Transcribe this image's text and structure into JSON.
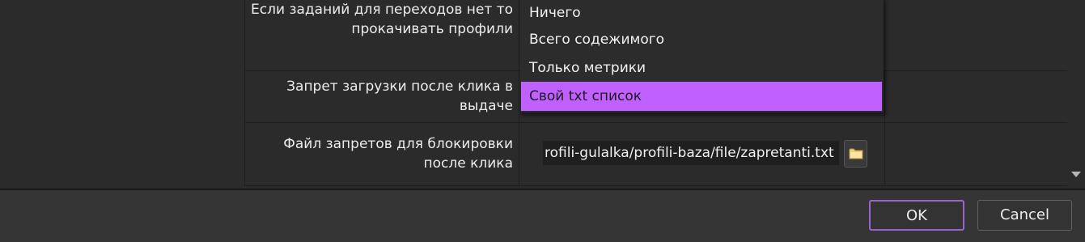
{
  "settings": {
    "rows": [
      {
        "label_line1": "Если заданий для переходов нет то",
        "label_line2": "прокачивать профили"
      },
      {
        "label_line1": "Запрет загрузки после клика в",
        "label_line2": "выдаче"
      },
      {
        "label_line1": "Файл запретов для блокировки",
        "label_line2": "после клика"
      }
    ],
    "file_path_value": "rofili-gulalka/profili-baza/file/zapretanti.txt",
    "browse_icon": "folder-icon"
  },
  "dropdown": {
    "options": [
      "Ничего",
      "Всего содежимого",
      "Только метрики",
      "Свой txt список"
    ],
    "selected": "Свой txt список",
    "highlight_color": "#c060ff"
  },
  "footer": {
    "ok_label": "OK",
    "cancel_label": "Cancel",
    "ok_border_color": "#9a63d0"
  }
}
